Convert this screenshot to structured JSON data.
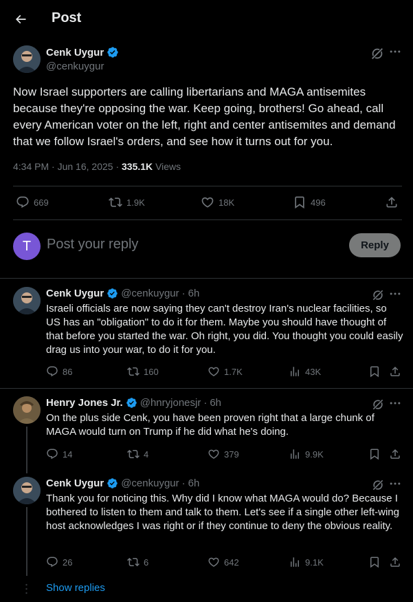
{
  "header": {
    "title": "Post",
    "back_icon": "arrow-left-icon"
  },
  "main_post": {
    "author_name": "Cenk Uygur",
    "author_handle": "@cenkuygur",
    "verified": true,
    "text": "Now Israel supporters are calling libertarians and MAGA antisemites because they're opposing the war. Keep going, brothers! Go ahead, call every American voter on the left, right and center antisemites and demand that we follow Israel's orders, and see how it turns out for you.",
    "time": "4:34 PM",
    "separator": "·",
    "date": "Jun 16, 2025",
    "views_count": "335.1K",
    "views_label": "Views",
    "stats": {
      "replies": "669",
      "reposts": "1.9K",
      "likes": "18K",
      "bookmarks": "496"
    }
  },
  "reply_box": {
    "avatar_letter": "T",
    "placeholder": "Post your reply",
    "button_label": "Reply"
  },
  "replies": [
    {
      "author_name": "Cenk Uygur",
      "author_handle": "@cenkuygur",
      "time_ago": "6h",
      "separator": "·",
      "verified": true,
      "text": "Israeli officials are now saying they can't destroy Iran's nuclear facilities, so US has an \"obligation\" to do it for them. Maybe you should have thought of that before you started the war. Oh right, you did. You thought you could easily drag us into your war, to do it for you.",
      "stats": {
        "replies": "86",
        "reposts": "160",
        "likes": "1.7K",
        "views": "43K"
      }
    },
    {
      "author_name": "Henry Jones Jr.",
      "author_handle": "@hnryjonesjr",
      "time_ago": "6h",
      "separator": "·",
      "verified": true,
      "text": "On the plus side Cenk, you have been proven right that a large chunk of MAGA would turn on Trump if he did what he's doing.",
      "stats": {
        "replies": "14",
        "reposts": "4",
        "likes": "379",
        "views": "9.9K"
      }
    },
    {
      "author_name": "Cenk Uygur",
      "author_handle": "@cenkuygur",
      "time_ago": "6h",
      "separator": "·",
      "verified": true,
      "text": "Thank you for noticing this. Why did I know what MAGA would do? Because I bothered to listen to them and talk to them. Let's see if a single other left-wing host acknowledges I was right or if they continue to deny the obvious reality.",
      "stats": {
        "replies": "26",
        "reposts": "6",
        "likes": "642",
        "views": "9.1K"
      }
    }
  ],
  "show_replies_label": "Show replies",
  "colors": {
    "background": "#000000",
    "text": "#e7e9ea",
    "muted": "#71767b",
    "accent": "#1d9bf0",
    "border": "#2f3336"
  }
}
